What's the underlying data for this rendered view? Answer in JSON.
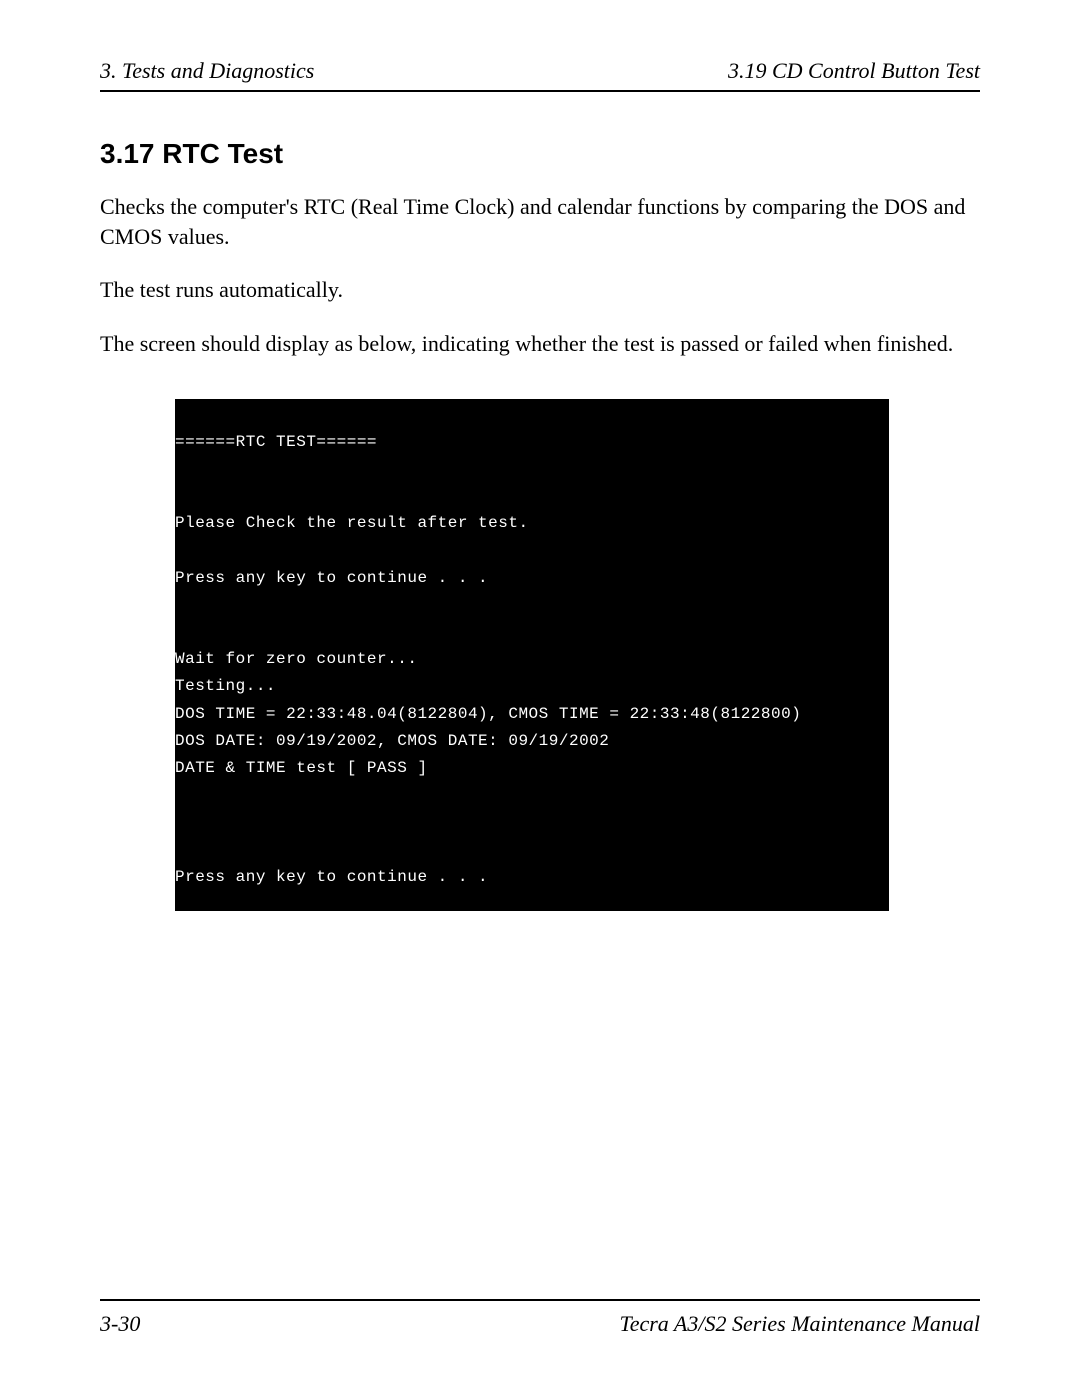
{
  "header": {
    "left": "3.  Tests and Diagnostics",
    "right": "3.19  CD Control Button Test"
  },
  "section": {
    "heading": "3.17  RTC Test",
    "para1": "Checks the computer's RTC (Real Time Clock) and calendar functions by comparing the DOS and CMOS values.",
    "para2": "The test runs automatically.",
    "para3": "The screen should display as below, indicating whether the test is passed or failed when finished."
  },
  "terminal": {
    "line1": "======RTC TEST======",
    "line2": "Please Check the result after test.",
    "line3": "Press any key to continue . . .",
    "line4": "Wait for zero counter...",
    "line5": "Testing...",
    "line6": "DOS TIME = 22:33:48.04(8122804), CMOS TIME = 22:33:48(8122800)",
    "line7": "DOS DATE: 09/19/2002, CMOS DATE: 09/19/2002",
    "line8": "DATE & TIME test [ PASS ]",
    "line9": "Press any key to continue . . ."
  },
  "footer": {
    "left": "3-30",
    "right": "Tecra A3/S2 Series Maintenance Manual"
  }
}
